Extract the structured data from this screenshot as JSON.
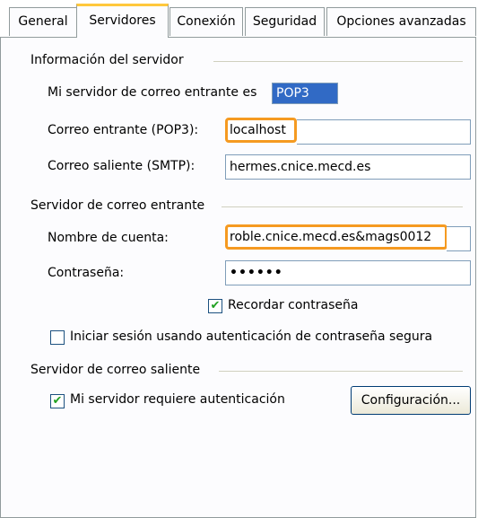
{
  "tabs": [
    {
      "label": "General"
    },
    {
      "label": "Servidores"
    },
    {
      "label": "Conexión"
    },
    {
      "label": "Seguridad"
    },
    {
      "label": "Opciones avanzadas"
    }
  ],
  "server_info": {
    "title": "Información del servidor",
    "incoming_type_label": "Mi servidor de correo entrante es",
    "incoming_type_value": "POP3",
    "incoming_label": "Correo entrante (POP3):",
    "incoming_value": "localhost",
    "outgoing_label": "Correo saliente (SMTP):",
    "outgoing_value": "hermes.cnice.mecd.es"
  },
  "incoming_server": {
    "title": "Servidor de correo entrante",
    "account_label": "Nombre de cuenta:",
    "account_value": "roble.cnice.mecd.es&mags0012",
    "password_label": "Contraseña:",
    "password_value": "••••••",
    "remember_label": "Recordar contraseña",
    "remember_checked": true,
    "spa_label": "Iniciar sesión usando autenticación de contraseña segura",
    "spa_checked": false
  },
  "outgoing_server": {
    "title": "Servidor de correo saliente",
    "auth_label": "Mi servidor requiere autenticación",
    "auth_checked": true,
    "config_button": "Configuración..."
  },
  "colors": {
    "highlight": "#f59a21",
    "selection": "#316ac5",
    "check": "#21a121"
  }
}
